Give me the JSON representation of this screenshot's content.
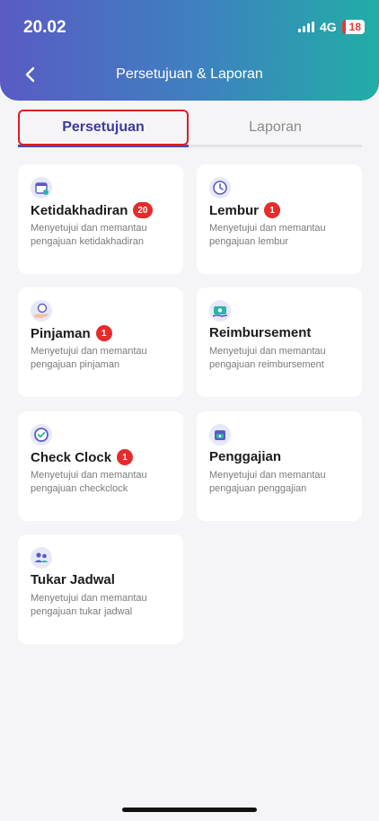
{
  "status": {
    "time": "20.02",
    "network": "4G",
    "battery": "18"
  },
  "header": {
    "title": "Persetujuan & Laporan"
  },
  "tabs": {
    "active": "Persetujuan",
    "inactive": "Laporan"
  },
  "cards": [
    {
      "title": "Ketidakhadiran",
      "badge": "20",
      "desc": "Menyetujui dan memantau pengajuan ketidakhadiran"
    },
    {
      "title": "Lembur",
      "badge": "1",
      "desc": "Menyetujui dan memantau pengajuan lembur"
    },
    {
      "title": "Pinjaman",
      "badge": "1",
      "desc": "Menyetujui dan memantau pengajuan pinjaman"
    },
    {
      "title": "Reimbursement",
      "badge": "",
      "desc": "Menyetujui dan memantau pengajuan reimbursement"
    },
    {
      "title": "Check Clock",
      "badge": "1",
      "desc": "Menyetujui dan memantau pengajuan checkclock"
    },
    {
      "title": "Penggajian",
      "badge": "",
      "desc": "Menyetujui dan memantau pengajuan penggajian"
    },
    {
      "title": "Tukar Jadwal",
      "badge": "",
      "desc": "Menyetujui dan memantau pengajuan tukar jadwal"
    }
  ],
  "colors": {
    "accent": "#4b4ab6",
    "badge": "#e52b2b",
    "highlight": "#e01c24"
  }
}
